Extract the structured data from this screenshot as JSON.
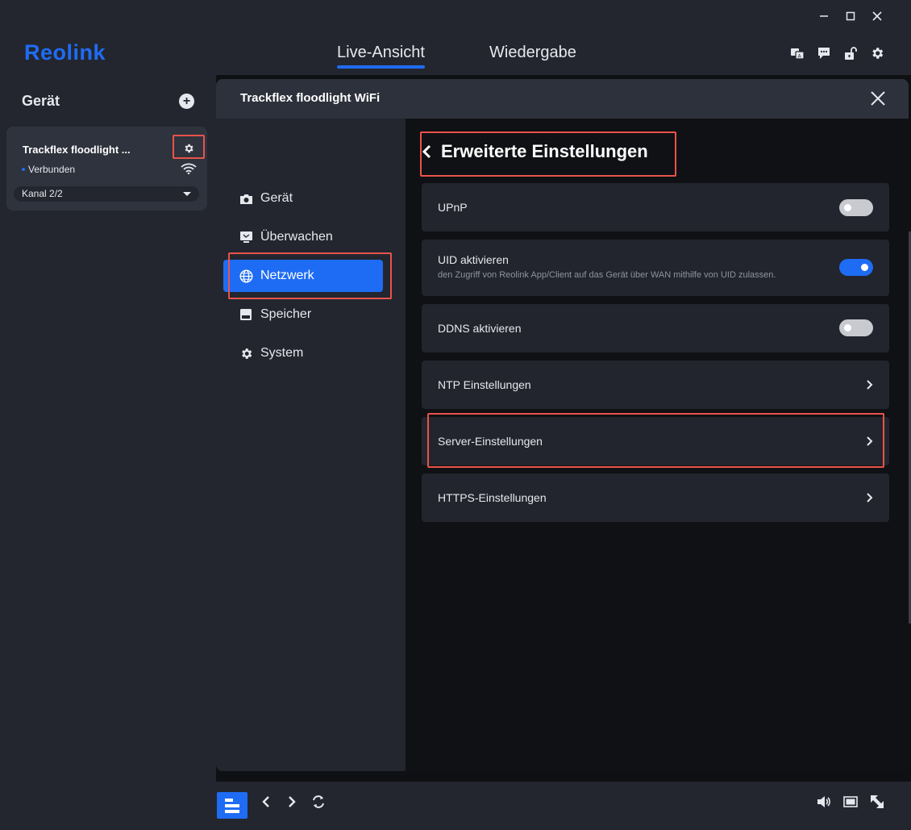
{
  "window": {
    "minimize": "–",
    "maximize": "□",
    "close": "✕"
  },
  "header": {
    "logo": "Reolink",
    "tabs": [
      {
        "label": "Live-Ansicht",
        "active": true
      },
      {
        "label": "Wiedergabe",
        "active": false
      }
    ],
    "icons": [
      "translate-icon",
      "message-icon",
      "unlock-icon",
      "settings-icon"
    ]
  },
  "sidebar": {
    "title": "Gerät",
    "device": {
      "name": "Trackflex floodlight ...",
      "status": "Verbunden",
      "channel": "Kanal 2/2"
    }
  },
  "dialog": {
    "title": "Trackflex floodlight WiFi",
    "nav": [
      {
        "label": "Gerät",
        "icon": "camera-icon",
        "active": false
      },
      {
        "label": "Überwachen",
        "icon": "monitor-icon",
        "active": false
      },
      {
        "label": "Netzwerk",
        "icon": "globe-icon",
        "active": true
      },
      {
        "label": "Speicher",
        "icon": "storage-icon",
        "active": false
      },
      {
        "label": "System",
        "icon": "gear-icon",
        "active": false
      }
    ],
    "section_title": "Erweiterte Einstellungen",
    "settings": [
      {
        "label": "UPnP",
        "type": "toggle",
        "value": false
      },
      {
        "label": "UID aktivieren",
        "description": "den Zugriff von Reolink App/Client auf das Gerät über WAN mithilfe von UID zulassen.",
        "type": "toggle",
        "value": true
      },
      {
        "label": "DDNS aktivieren",
        "type": "toggle",
        "value": false
      },
      {
        "label": "NTP Einstellungen",
        "type": "link"
      },
      {
        "label": "Server-Einstellungen",
        "type": "link"
      },
      {
        "label": "HTTPS-Einstellungen",
        "type": "link"
      }
    ]
  },
  "colors": {
    "accent": "#1f6cf4",
    "highlight": "#e9534a",
    "panel": "#23262f",
    "row": "#22252d"
  }
}
